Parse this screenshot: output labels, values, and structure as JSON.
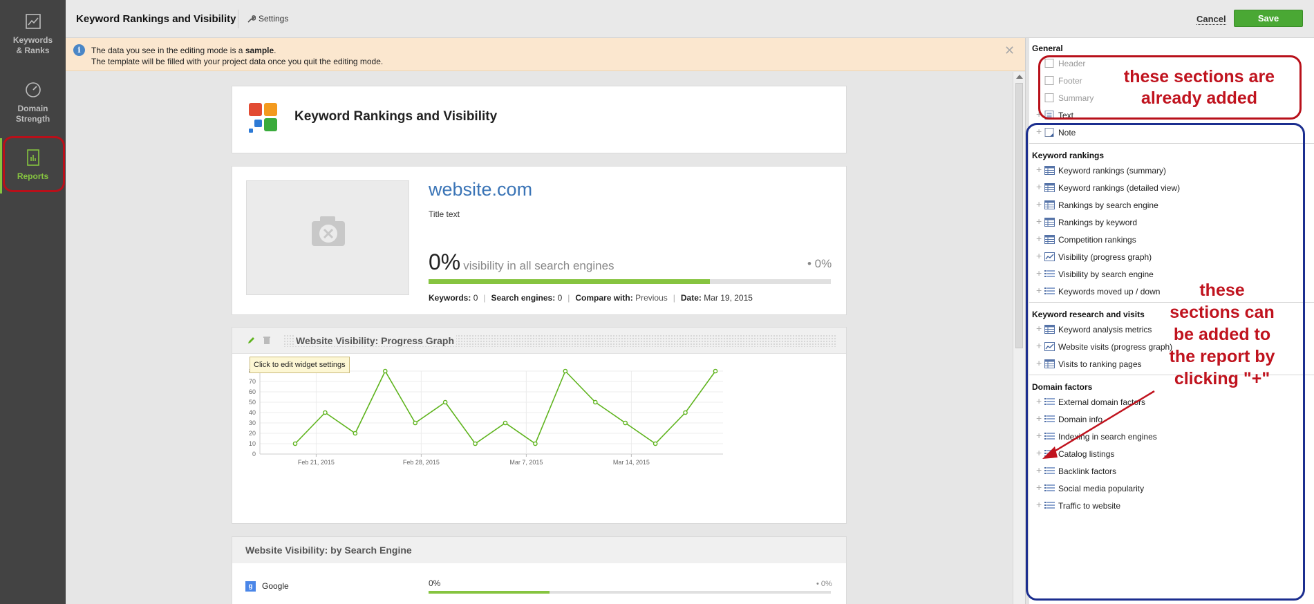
{
  "nav": {
    "items": [
      {
        "label_1": "Keywords",
        "label_2": "& Ranks",
        "icon": "chart-icon"
      },
      {
        "label_1": "Domain",
        "label_2": "Strength",
        "icon": "gauge-icon"
      },
      {
        "label_1": "Reports",
        "label_2": "",
        "icon": "report-icon",
        "active": true
      }
    ]
  },
  "toolbar": {
    "title": "Keyword Rankings and Visibility",
    "settings_label": "Settings",
    "cancel_label": "Cancel",
    "save_label": "Save"
  },
  "notice": {
    "line1_prefix": "The data you see in the editing mode is a ",
    "line1_bold": "sample",
    "line1_suffix": ".",
    "line2": "The template will be filled with your project data once you quit the editing mode."
  },
  "report": {
    "header_title": "Keyword Rankings and Visibility",
    "site": "website.com",
    "title_text": "Title text",
    "visibility_value": "0%",
    "visibility_label": "visibility in all search engines",
    "visibility_change": "• 0%",
    "visibility_progress": 0.7,
    "meta": {
      "keywords_label": "Keywords:",
      "keywords_value": "0",
      "engines_label": "Search engines:",
      "engines_value": "0",
      "compare_label": "Compare with:",
      "compare_value": "Previous",
      "date_label": "Date:",
      "date_value": "Mar 19, 2015"
    },
    "widget_title": "Website Visibility: Progress Graph",
    "tooltip": "Click to edit widget settings",
    "widget2_title": "Website Visibility: by Search Engine",
    "engine_name": "Google",
    "engine_pct": "0%",
    "engine_change": "• 0%",
    "engine_progress": 0.3
  },
  "chart_data": {
    "type": "line",
    "x_ticks": [
      "Feb 21, 2015",
      "Feb 28, 2015",
      "Mar 7, 2015",
      "Mar 14, 2015"
    ],
    "y_ticks": [
      0,
      10,
      20,
      30,
      40,
      50,
      60,
      70,
      80
    ],
    "ylim": [
      0,
      80
    ],
    "grid": true,
    "series": [
      {
        "color": "#5fb41e",
        "values": [
          10,
          40,
          20,
          80,
          30,
          50,
          10,
          30,
          10,
          80,
          50,
          30,
          10,
          40,
          80
        ]
      }
    ]
  },
  "panel": {
    "sections": [
      {
        "title": "General",
        "items": [
          {
            "label": "Header",
            "icon": "checkbox-icon",
            "disabled": true
          },
          {
            "label": "Footer",
            "icon": "checkbox-icon",
            "disabled": true
          },
          {
            "label": "Summary",
            "icon": "checkbox-icon",
            "disabled": true
          },
          {
            "label": "Text",
            "icon": "text-icon"
          },
          {
            "label": "Note",
            "icon": "note-icon"
          }
        ]
      },
      {
        "title": "Keyword rankings",
        "items": [
          {
            "label": "Keyword rankings (summary)",
            "icon": "table-icon"
          },
          {
            "label": "Keyword rankings (detailed view)",
            "icon": "table-icon"
          },
          {
            "label": "Rankings by search engine",
            "icon": "table-icon"
          },
          {
            "label": "Rankings by keyword",
            "icon": "table-icon"
          },
          {
            "label": "Competition rankings",
            "icon": "table-icon"
          },
          {
            "label": "Visibility (progress graph)",
            "icon": "graph-icon"
          },
          {
            "label": "Visibility by search engine",
            "icon": "list-icon"
          },
          {
            "label": "Keywords moved up / down",
            "icon": "list-icon"
          }
        ]
      },
      {
        "title": "Keyword research and visits",
        "items": [
          {
            "label": "Keyword analysis metrics",
            "icon": "table-icon"
          },
          {
            "label": "Website visits (progress graph)",
            "icon": "graph-icon"
          },
          {
            "label": "Visits to ranking pages",
            "icon": "table-icon"
          }
        ]
      },
      {
        "title": "Domain factors",
        "items": [
          {
            "label": "External domain factors",
            "icon": "list-icon"
          },
          {
            "label": "Domain info",
            "icon": "list-icon"
          },
          {
            "label": "Indexing in search engines",
            "icon": "list-icon"
          },
          {
            "label": "Catalog listings",
            "icon": "list-icon"
          },
          {
            "label": "Backlink factors",
            "icon": "list-icon"
          },
          {
            "label": "Social media popularity",
            "icon": "list-icon"
          },
          {
            "label": "Traffic to website",
            "icon": "list-icon"
          }
        ]
      }
    ]
  },
  "annotations": {
    "added_1": "these sections are",
    "added_2": "already added",
    "can_1": "these",
    "can_2": "sections can",
    "can_3": "be added to",
    "can_4": "the report by",
    "can_5": "clicking \"+\"",
    "annot_color_red": "#c0131e",
    "annot_color_blue": "#1b2e8f"
  },
  "colors": {
    "accent": "#86c440",
    "save": "#4aa834",
    "link": "#3a74b6"
  }
}
